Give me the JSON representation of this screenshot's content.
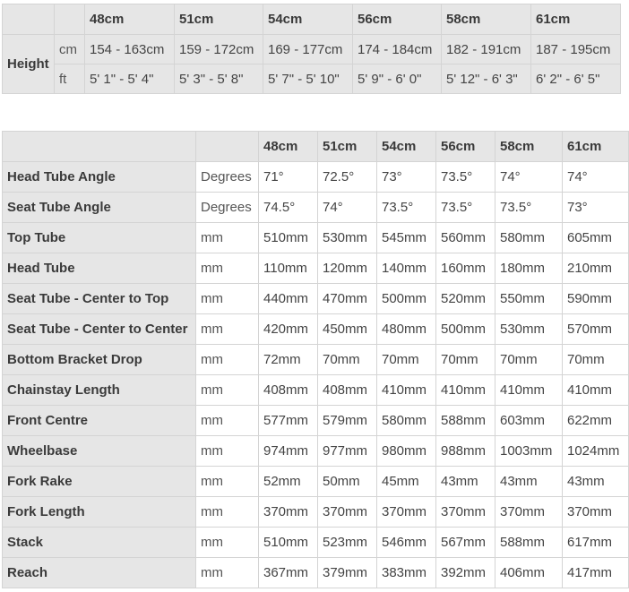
{
  "height_table": {
    "sizes": [
      "48cm",
      "51cm",
      "54cm",
      "56cm",
      "58cm",
      "61cm"
    ],
    "row_label": "Height",
    "rows": [
      {
        "unit": "cm",
        "values": [
          "154 - 163cm",
          "159 - 172cm",
          "169 - 177cm",
          "174 - 184cm",
          "182 - 191cm",
          "187 - 195cm"
        ]
      },
      {
        "unit": "ft",
        "values": [
          "5' 1\" - 5' 4\"",
          "5' 3\" - 5' 8\"",
          "5' 7\" - 5' 10\"",
          "5' 9\" - 6' 0\"",
          "5' 12\" - 6' 3\"",
          "6' 2\" - 6' 5\""
        ]
      }
    ]
  },
  "geometry_table": {
    "sizes": [
      "48cm",
      "51cm",
      "54cm",
      "56cm",
      "58cm",
      "61cm"
    ],
    "rows": [
      {
        "label": "Head Tube Angle",
        "unit": "Degrees",
        "values": [
          "71°",
          "72.5°",
          "73°",
          "73.5°",
          "74°",
          "74°"
        ]
      },
      {
        "label": "Seat Tube Angle",
        "unit": "Degrees",
        "values": [
          "74.5°",
          "74°",
          "73.5°",
          "73.5°",
          "73.5°",
          "73°"
        ]
      },
      {
        "label": "Top Tube",
        "unit": "mm",
        "values": [
          "510mm",
          "530mm",
          "545mm",
          "560mm",
          "580mm",
          "605mm"
        ]
      },
      {
        "label": "Head Tube",
        "unit": "mm",
        "values": [
          "110mm",
          "120mm",
          "140mm",
          "160mm",
          "180mm",
          "210mm"
        ]
      },
      {
        "label": "Seat Tube - Center to Top",
        "unit": "mm",
        "values": [
          "440mm",
          "470mm",
          "500mm",
          "520mm",
          "550mm",
          "590mm"
        ]
      },
      {
        "label": "Seat Tube - Center to Center",
        "unit": "mm",
        "values": [
          "420mm",
          "450mm",
          "480mm",
          "500mm",
          "530mm",
          "570mm"
        ]
      },
      {
        "label": "Bottom Bracket Drop",
        "unit": "mm",
        "values": [
          "72mm",
          "70mm",
          "70mm",
          "70mm",
          "70mm",
          "70mm"
        ]
      },
      {
        "label": "Chainstay Length",
        "unit": "mm",
        "values": [
          "408mm",
          "408mm",
          "410mm",
          "410mm",
          "410mm",
          "410mm"
        ]
      },
      {
        "label": "Front Centre",
        "unit": "mm",
        "values": [
          "577mm",
          "579mm",
          "580mm",
          "588mm",
          "603mm",
          "622mm"
        ]
      },
      {
        "label": "Wheelbase",
        "unit": "mm",
        "values": [
          "974mm",
          "977mm",
          "980mm",
          "988mm",
          "1003mm",
          "1024mm"
        ]
      },
      {
        "label": "Fork Rake",
        "unit": "mm",
        "values": [
          "52mm",
          "50mm",
          "45mm",
          "43mm",
          "43mm",
          "43mm"
        ]
      },
      {
        "label": "Fork Length",
        "unit": "mm",
        "values": [
          "370mm",
          "370mm",
          "370mm",
          "370mm",
          "370mm",
          "370mm"
        ]
      },
      {
        "label": "Stack",
        "unit": "mm",
        "values": [
          "510mm",
          "523mm",
          "546mm",
          "567mm",
          "588mm",
          "617mm"
        ]
      },
      {
        "label": "Reach",
        "unit": "mm",
        "values": [
          "367mm",
          "379mm",
          "383mm",
          "392mm",
          "406mm",
          "417mm"
        ]
      }
    ]
  }
}
